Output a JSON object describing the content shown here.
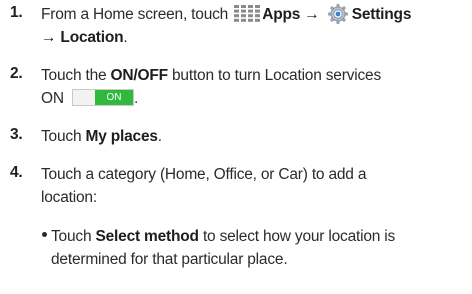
{
  "steps": [
    {
      "number": "1.",
      "prefix": "From a Home screen, touch",
      "apps": "Apps",
      "arrow1": "→",
      "settings": "Settings",
      "arrow2": "→",
      "location": "Location",
      "period": "."
    },
    {
      "number": "2.",
      "pre": "Touch the",
      "bold": "ON/OFF",
      "post": "button to turn Location services",
      "line2": "ON",
      "toggle_label": "ON",
      "toggle_period": "."
    },
    {
      "number": "3.",
      "pre": "Touch",
      "bold": "My places",
      "period": "."
    },
    {
      "number": "4.",
      "line1": "Touch a category (Home, Office, or Car) to add a",
      "line2": "location:"
    }
  ],
  "bullet": {
    "pre": "Touch",
    "bold": "Select method",
    "post": "to select how your location is",
    "line2": "determined for that particular place."
  },
  "icons": {
    "apps": "apps-grid-icon",
    "settings": "settings-gear-icon"
  },
  "colors": {
    "toggle_on": "#2fb93f",
    "text": "#2b2b2b"
  }
}
